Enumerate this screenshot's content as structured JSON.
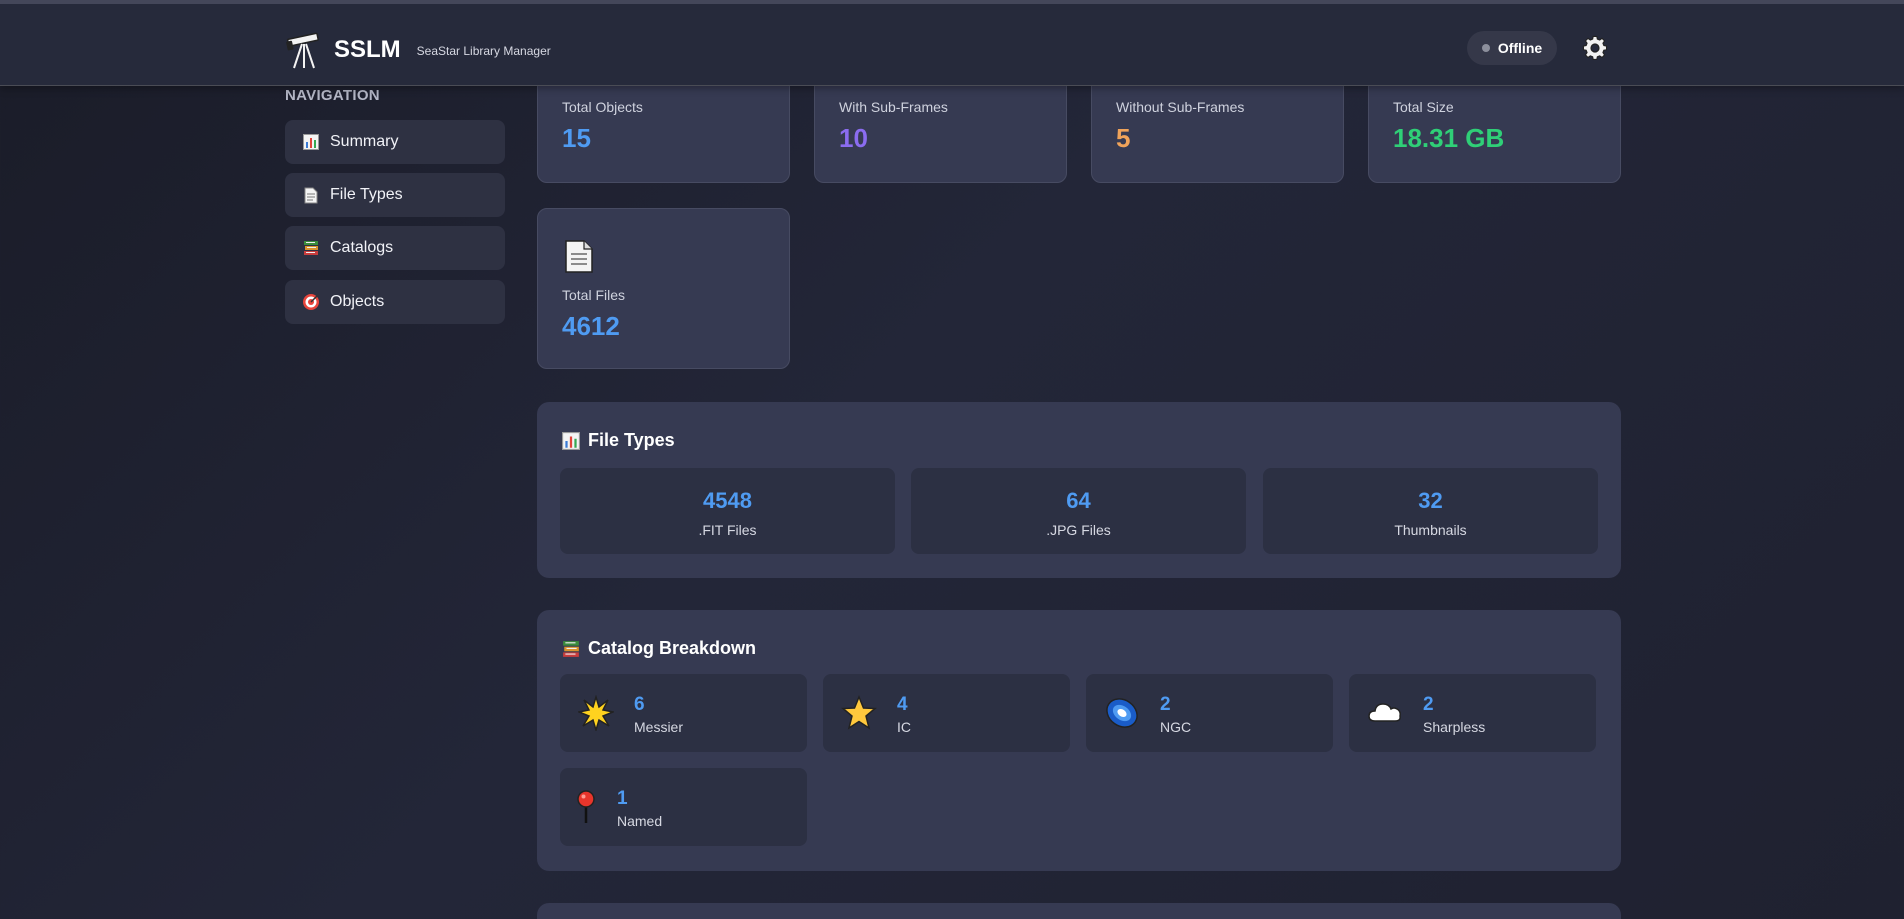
{
  "header": {
    "title": "SSLM",
    "subtitle": "SeaStar Library Manager",
    "status": "Offline",
    "icons": {
      "brand": "telescope-icon",
      "settings": "gear-icon"
    }
  },
  "sidebar": {
    "heading": "NAVIGATION",
    "items": [
      {
        "label": "Summary",
        "icon": "bar-chart-icon"
      },
      {
        "label": "File Types",
        "icon": "document-icon"
      },
      {
        "label": "Catalogs",
        "icon": "books-icon"
      },
      {
        "label": "Objects",
        "icon": "target-icon"
      }
    ]
  },
  "stats": [
    {
      "label": "Total Objects",
      "value": "15",
      "color": "#4f9bf2"
    },
    {
      "label": "With Sub-Frames",
      "value": "10",
      "color": "#8b6cf0"
    },
    {
      "label": "Without Sub-Frames",
      "value": "5",
      "color": "#f0a35a"
    },
    {
      "label": "Total Size",
      "value": "18.31 GB",
      "color": "#2fcf77"
    },
    {
      "label": "Total Files",
      "value": "4612",
      "color": "#4f9bf2",
      "icon": "document-icon"
    }
  ],
  "file_types": {
    "title": "File Types",
    "icon": "bar-chart-icon",
    "items": [
      {
        "count": "4548",
        "label": ".FIT Files"
      },
      {
        "count": "64",
        "label": ".JPG Files"
      },
      {
        "count": "32",
        "label": "Thumbnails"
      }
    ]
  },
  "catalogs": {
    "title": "Catalog Breakdown",
    "icon": "books-icon",
    "items": [
      {
        "count": "6",
        "label": "Messier",
        "icon": "glowing-star-icon"
      },
      {
        "count": "4",
        "label": "IC",
        "icon": "star-icon"
      },
      {
        "count": "2",
        "label": "NGC",
        "icon": "galaxy-icon"
      },
      {
        "count": "2",
        "label": "Sharpless",
        "icon": "cloud-icon"
      },
      {
        "count": "1",
        "label": "Named",
        "icon": "pin-icon"
      }
    ]
  },
  "colors": {
    "accent_blue": "#4f9bf2",
    "accent_purple": "#8b6cf0",
    "accent_orange": "#f0a35a",
    "accent_green": "#2fcf77"
  }
}
